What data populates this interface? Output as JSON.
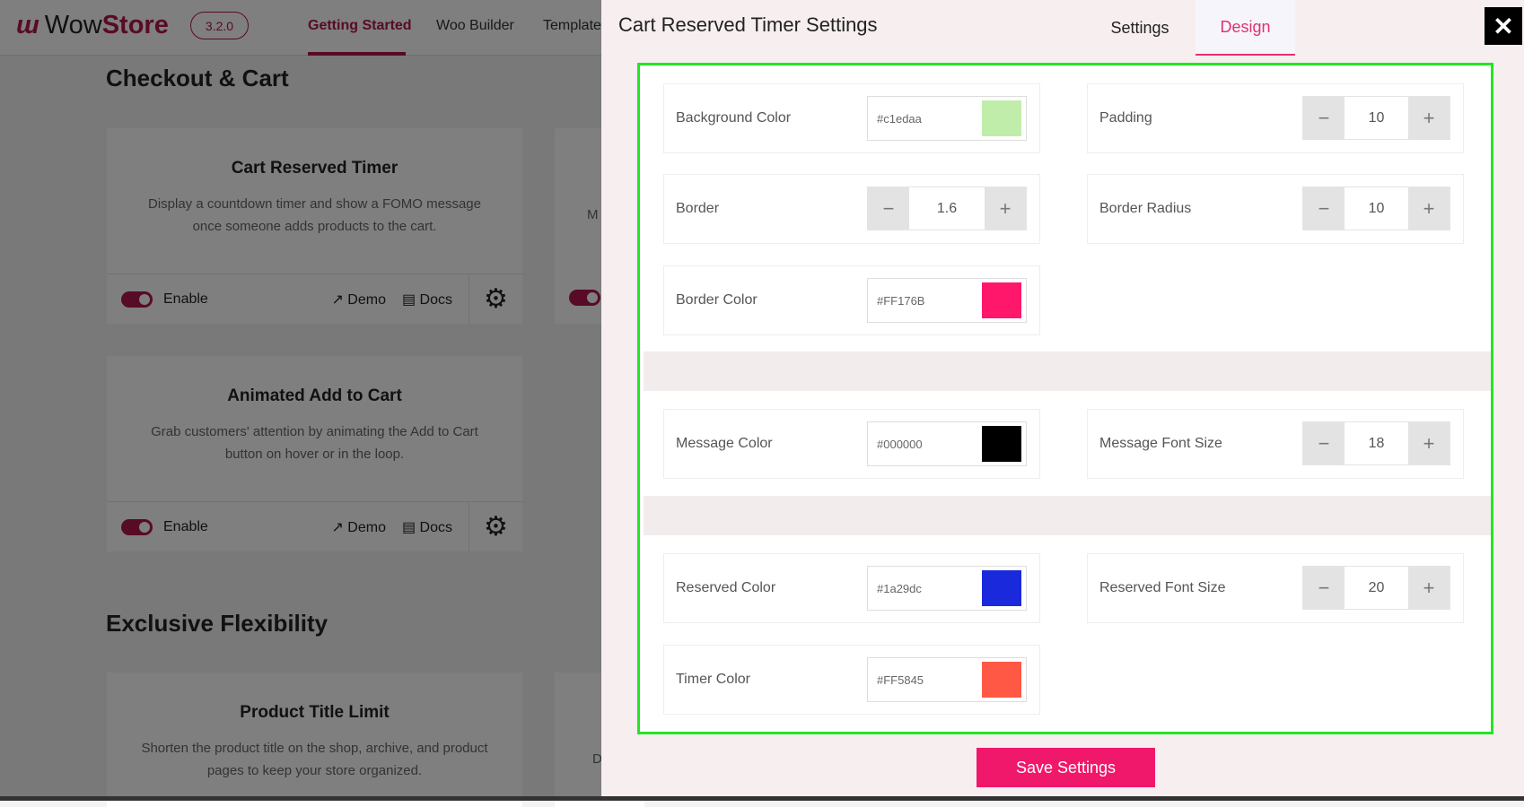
{
  "header": {
    "logo_prefix": "Wow",
    "logo_suffix": "Store",
    "version": "3.2.0",
    "nav": [
      "Getting Started",
      "Woo Builder",
      "Template"
    ]
  },
  "sections": [
    "Checkout & Cart",
    "Exclusive Flexibility"
  ],
  "cards": [
    {
      "title": "Cart Reserved Timer",
      "desc": "Display a countdown timer and show a FOMO message once someone adds products to the cart.",
      "enable": "Enable",
      "demo": "Demo",
      "docs": "Docs"
    },
    {
      "title": "Animated Add to Cart",
      "desc": "Grab customers' attention by animating the Add to Cart button on hover or in the loop.",
      "enable": "Enable",
      "demo": "Demo",
      "docs": "Docs"
    },
    {
      "title": "Product Title Limit",
      "desc": "Shorten the product title on the shop, archive, and product pages to keep your store organized."
    }
  ],
  "side_cards": {
    "text1": "M",
    "text2": "D"
  },
  "modal": {
    "title": "Cart Reserved Timer Settings",
    "tabs": [
      "Settings",
      "Design"
    ],
    "active_tab": "Design",
    "close": "✕",
    "save": "Save Settings",
    "fields": {
      "background_color": {
        "label": "Background Color",
        "value": "#c1edaa"
      },
      "padding": {
        "label": "Padding",
        "value": "10"
      },
      "border": {
        "label": "Border",
        "value": "1.6"
      },
      "border_radius": {
        "label": "Border Radius",
        "value": "10"
      },
      "border_color": {
        "label": "Border Color",
        "value": "#FF176B"
      },
      "message_color": {
        "label": "Message Color",
        "value": "#000000"
      },
      "message_font_size": {
        "label": "Message Font Size",
        "value": "18"
      },
      "reserved_color": {
        "label": "Reserved Color",
        "value": "#1a29dc"
      },
      "reserved_font_size": {
        "label": "Reserved Font Size",
        "value": "20"
      },
      "timer_color": {
        "label": "Timer Color",
        "value": "#FF5845"
      }
    }
  },
  "colors": {
    "accent": "#e2316f",
    "brand": "#b0164f",
    "highlight": "#22e622",
    "save": "#f0186a"
  }
}
